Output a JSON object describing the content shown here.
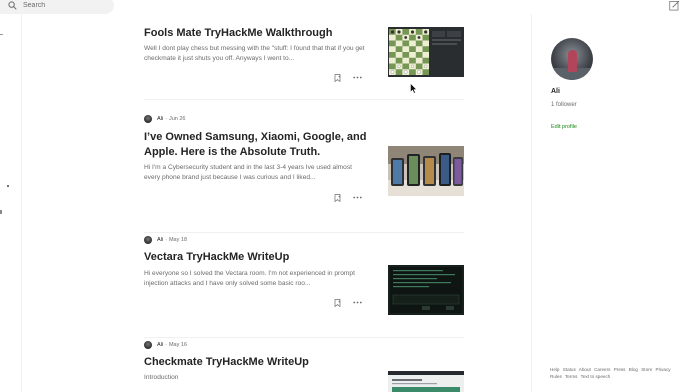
{
  "search": {
    "placeholder": "Search"
  },
  "profile": {
    "name": "Ali",
    "followers": "1 follower",
    "edit_label": "Edit profile"
  },
  "footer": {
    "links": [
      "Help",
      "Status",
      "About",
      "Careers",
      "Press",
      "Blog",
      "Store",
      "Privacy",
      "Rules",
      "Terms",
      "Text to speech"
    ]
  },
  "articles": [
    {
      "title": "Fools Mate TryHackMe Walkthrough",
      "excerpt": "Well I dont play chess but messing with the \"stuff: I found that that if you get checkmate it just shuts you off. Anyways I went to..."
    },
    {
      "author": "Ali",
      "date": "Jun 26",
      "title": "I’ve Owned Samsung, Xiaomi, Google, and Apple. Here is the Absolute Truth.",
      "excerpt": "Hi I'm a Cybersecurity student and in the last 3-4 years Ive used almost every phone brand just because I was curious and I liked..."
    },
    {
      "author": "Ali",
      "date": "May 18",
      "title": "Vectara TryHackMe WriteUp",
      "excerpt": "Hi everyone so I solved the Vectara room. I'm not experienced in prompt injection attacks and I have only solved some basic roo..."
    },
    {
      "author": "Ali",
      "date": "May 16",
      "title": "Checkmate TryHackMe WriteUp",
      "excerpt": "Introduction"
    }
  ],
  "icons": {
    "search": "search-icon",
    "write": "write-icon",
    "bookmark": "bookmark-icon",
    "more": "more-icon"
  },
  "colors": {
    "accent_green": "#1a8917",
    "text_primary": "#242424",
    "text_secondary": "#6b6b6b",
    "divider": "#f0f0f0"
  }
}
